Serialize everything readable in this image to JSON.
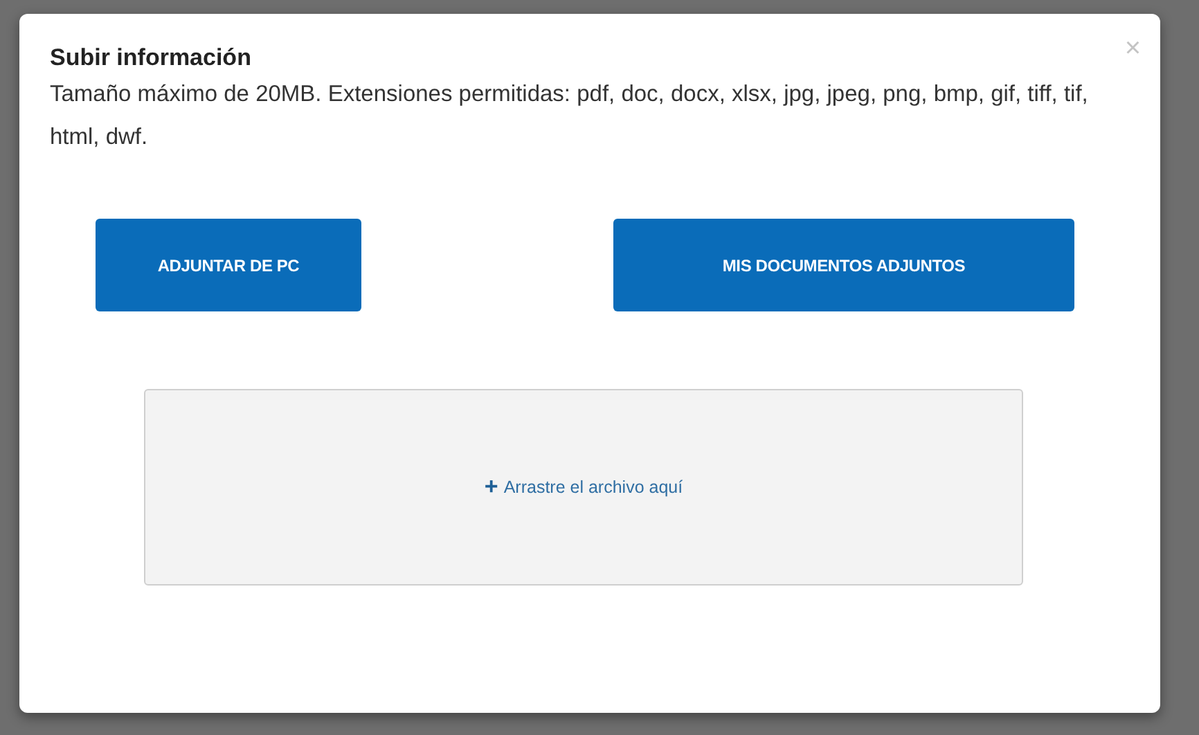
{
  "dialog": {
    "title": "Subir información",
    "description": "Tamaño máximo de 20MB. Extensiones permitidas: pdf, doc, docx, xlsx, jpg, jpeg, png, bmp, gif, tiff, tif, html, dwf.",
    "close": "×",
    "buttons": [
      "ADJUNTAR DE PC",
      "MIS DOCUMENTOS ADJUNTOS"
    ],
    "dropzone": {
      "icon": "+",
      "text": "Arrastre el archivo aquí"
    }
  }
}
